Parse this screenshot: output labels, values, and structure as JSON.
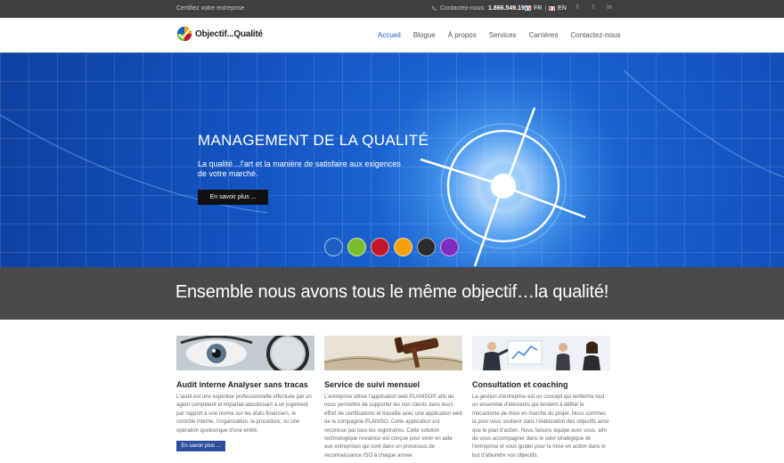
{
  "topbar": {
    "tagline": "Certifiez votre entreprise",
    "contact_label": "Contactez-nous:",
    "contact_phone": "1.866.549.1939",
    "lang_fr": "FR",
    "lang_sep": "|",
    "lang_en": "EN",
    "socials": [
      "f",
      "t",
      "in"
    ]
  },
  "logo": {
    "name": "Objectif...Qualité"
  },
  "nav": [
    "Accueil",
    "Blogue",
    "À propos",
    "Services",
    "Carrières",
    "Contactez-nous"
  ],
  "hero": {
    "title": "MANAGEMENT DE LA QUALITÉ",
    "subtitle": "La qualité…l'art et la manière de satisfaire aux exigences de votre marché.",
    "cta": "En savoir plus ...",
    "dots": [
      "#1e5fc4",
      "#79bd2b",
      "#c0172b",
      "#f2a20c",
      "#2b2b2b",
      "#7e2bbf"
    ]
  },
  "band": {
    "slogan": "Ensemble nous avons tous le même objectif…la qualité!"
  },
  "columns": [
    {
      "title": "Audit interne Analyser sans tracas",
      "text": "L'audit est une expertise professionnelle effectuée par un agent compétent et impartial aboutissant à un jugement par rapport à une norme sur les états financiers, le contrôle interne, l'organisation, la procédure, ou une opération quelconque d'une entité.",
      "button": "En savoir plus ..."
    },
    {
      "title": "Service de suivi mensuel",
      "text": "L'entreprise utilise l'application web PLANISO® afin de nous permettre de supporter les non clients dans leurs effort de certifications et travaille avec une application web de la compagnie PLANISO. Cette application est reconnue par tous les registraires. Cette solution technologique novatrice est conçue pour venir en aide aux entreprises qui sont dans un processus de reconnaissance ISO à chaque année"
    },
    {
      "title": "Consultation et coaching",
      "text": "La gestion d'entreprise est un concept qui renferme tout un ensemble d'éléments qui tendent à définir le mécanisme de mise en marche du projet. Nous sommes là pour vous soutenir dans l'élaboration des objectifs ainsi que le plan d'action. Nous faisons équipe avec vous, afin de vous accompagner dans le suivi stratégique de l'entreprise et vous guider pour la mise en action dans le but d'atteindre vos objectifs."
    }
  ]
}
